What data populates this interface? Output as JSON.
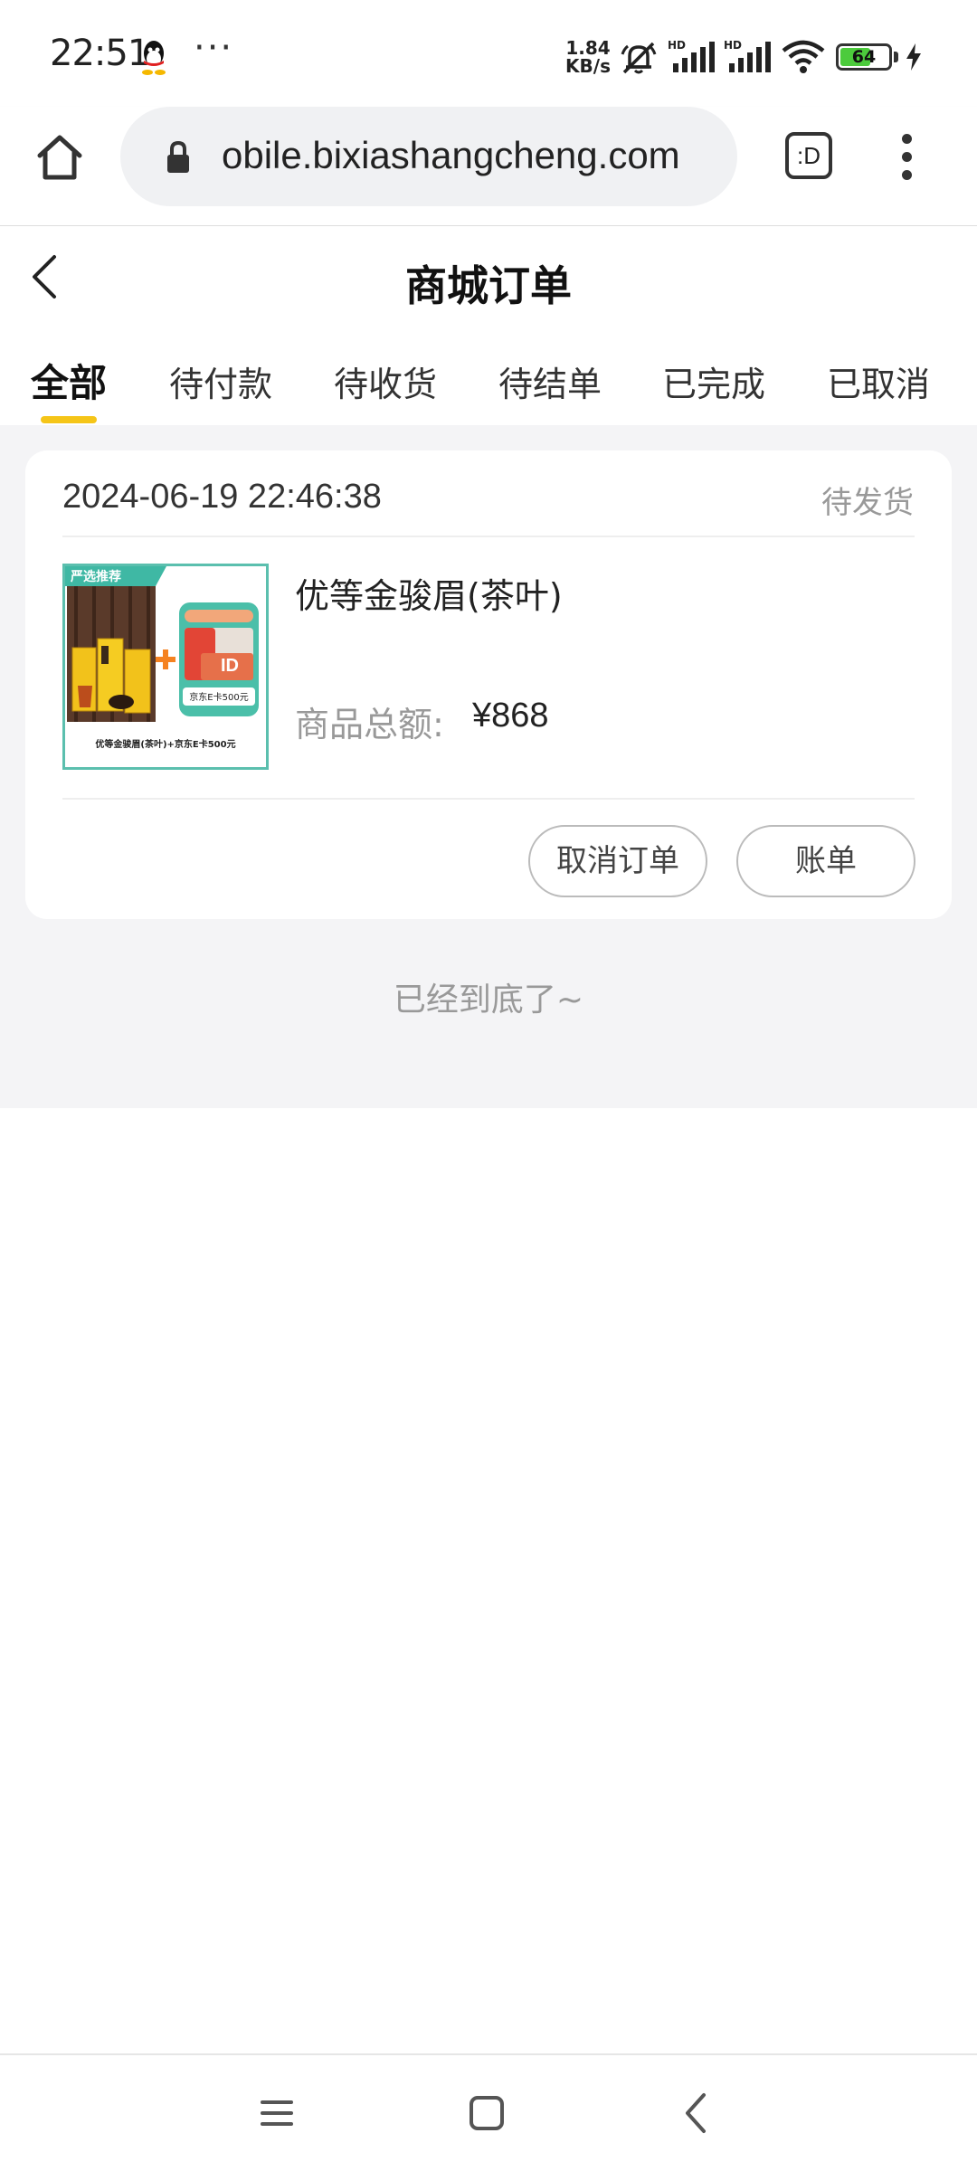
{
  "status_bar": {
    "time": "22:51",
    "more": "···",
    "net_speed_value": "1.84",
    "net_speed_unit": "KB/s",
    "battery": "64",
    "icons": [
      "qq-icon",
      "mute-icon",
      "signal-icon",
      "wifi-icon",
      "battery-icon",
      "charging-icon"
    ]
  },
  "browser": {
    "url": "obile.bixiashangcheng.com",
    "tabs_label": ":D",
    "icons": [
      "home-icon",
      "lock-icon",
      "tabs-icon",
      "menu-icon"
    ]
  },
  "header": {
    "title": "商城订单"
  },
  "tabs": [
    {
      "label": "全部",
      "active": true
    },
    {
      "label": "待付款"
    },
    {
      "label": "待收货"
    },
    {
      "label": "待结单"
    },
    {
      "label": "已完成"
    },
    {
      "label": "已取消"
    }
  ],
  "order": {
    "time": "2024-06-19 22:46:38",
    "status": "待发货",
    "product_name": "优等金骏眉(茶叶)",
    "total_label": "商品总额:",
    "total_value": "¥868",
    "image": {
      "banner": "严选推荐",
      "card_label": "京东E卡500元",
      "caption": "优等金骏眉(茶叶)+京东E卡500元"
    },
    "buttons": {
      "cancel": "取消订单",
      "bill": "账单"
    }
  },
  "end_text": "已经到底了~",
  "colors": {
    "accent": "#f5c518",
    "background": "#f4f4f6",
    "muted_text": "#999999",
    "image_border": "#5bbfae"
  }
}
